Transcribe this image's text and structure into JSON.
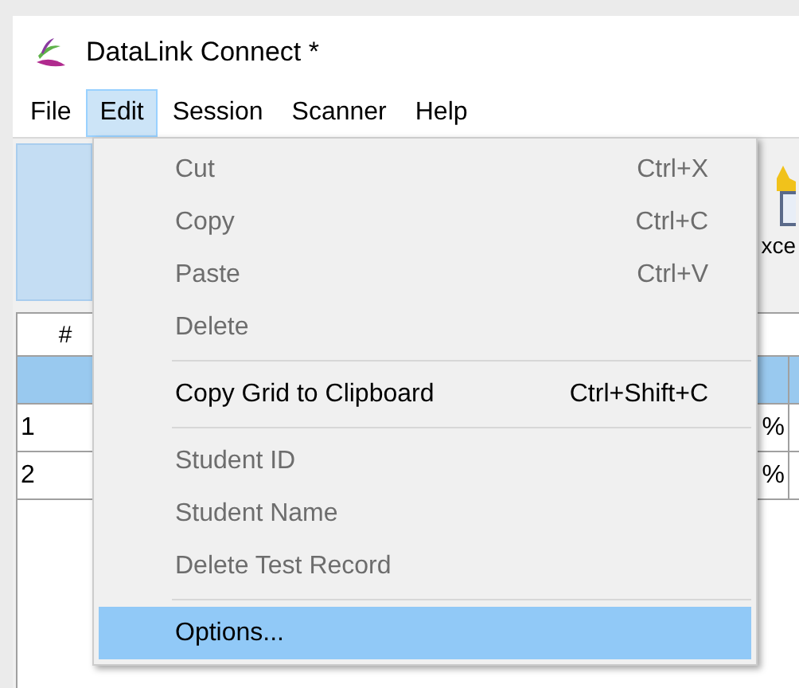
{
  "window": {
    "title": "DataLink Connect *"
  },
  "menu_bar": [
    {
      "label": "File",
      "selected": false
    },
    {
      "label": "Edit",
      "selected": true
    },
    {
      "label": "Session",
      "selected": false
    },
    {
      "label": "Scanner",
      "selected": false
    },
    {
      "label": "Help",
      "selected": false
    }
  ],
  "toolbar": {
    "buttons": [
      {
        "selected": true
      },
      {
        "label": "xce",
        "selected": false
      }
    ]
  },
  "table": {
    "columns": [
      "#"
    ],
    "rows": [
      {
        "selected": true
      },
      {
        "selected": false,
        "number": "1",
        "value": "%"
      },
      {
        "selected": false,
        "number": "2",
        "value": "%"
      }
    ]
  },
  "edit_menu": [
    {
      "kind": "item",
      "label": "Cut",
      "shortcut": "Ctrl+X",
      "disabled": true,
      "selected": false
    },
    {
      "kind": "item",
      "label": "Copy",
      "shortcut": "Ctrl+C",
      "disabled": true,
      "selected": false
    },
    {
      "kind": "item",
      "label": "Paste",
      "shortcut": "Ctrl+V",
      "disabled": true,
      "selected": false
    },
    {
      "kind": "item",
      "label": "Delete",
      "disabled": true,
      "selected": false
    },
    {
      "kind": "separator"
    },
    {
      "kind": "item",
      "label": "Copy Grid to Clipboard",
      "shortcut": "Ctrl+Shift+C",
      "disabled": false,
      "selected": false
    },
    {
      "kind": "separator"
    },
    {
      "kind": "item",
      "label": "Student ID",
      "disabled": true,
      "selected": false
    },
    {
      "kind": "item",
      "label": "Student Name",
      "disabled": true,
      "selected": false
    },
    {
      "kind": "item",
      "label": "Delete Test Record",
      "disabled": true,
      "selected": false
    },
    {
      "kind": "separator"
    },
    {
      "kind": "item",
      "label": "Options...",
      "disabled": false,
      "selected": true
    }
  ]
}
